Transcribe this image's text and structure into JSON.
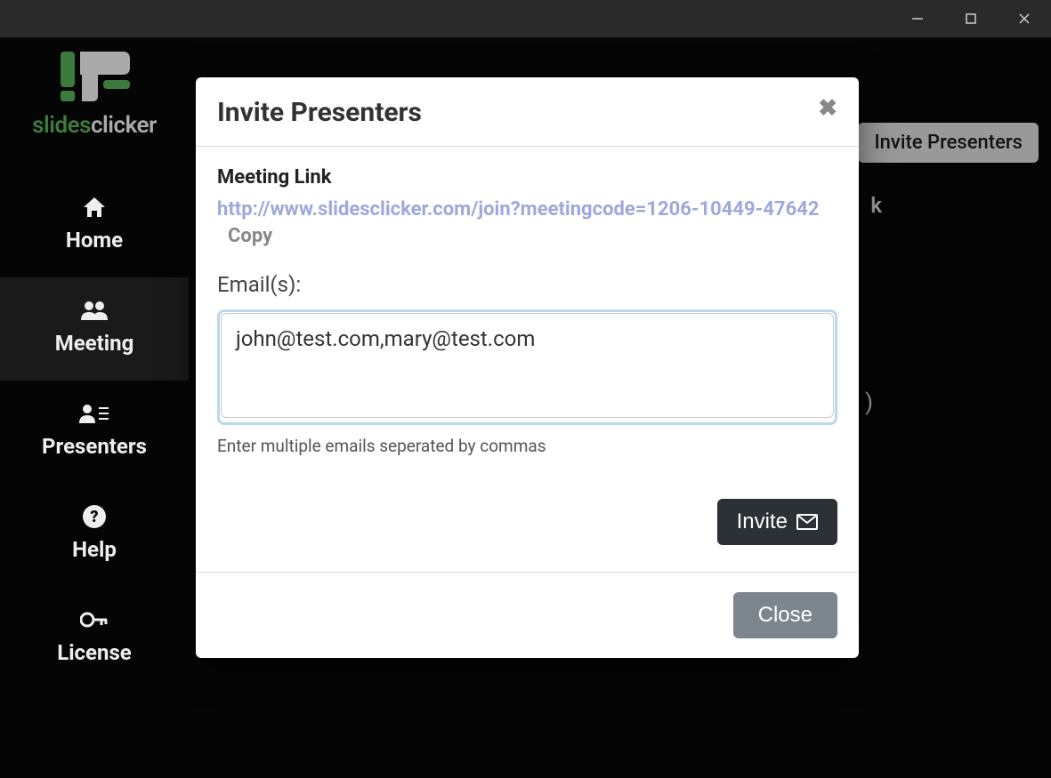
{
  "app_name": {
    "part1": "slides",
    "part2": "clicker"
  },
  "sidebar": {
    "items": [
      {
        "label": "Home"
      },
      {
        "label": "Meeting"
      },
      {
        "label": "Presenters"
      },
      {
        "label": "Help"
      },
      {
        "label": "License"
      }
    ]
  },
  "background": {
    "invite_button": "Invite Presenters",
    "word_fragment": "k",
    "paren": ")"
  },
  "modal": {
    "title": "Invite Presenters",
    "close_glyph": "✖",
    "meeting_link_label": "Meeting Link",
    "meeting_link": "http://www.slidesclicker.com/join?meetingcode=1206-10449-47642",
    "copy_label": "Copy",
    "emails_label": "Email(s):",
    "emails_value": "john@test.com,mary@test.com",
    "emails_hint": "Enter multiple emails seperated by commas",
    "invite_label": "Invite",
    "close_label": "Close"
  }
}
